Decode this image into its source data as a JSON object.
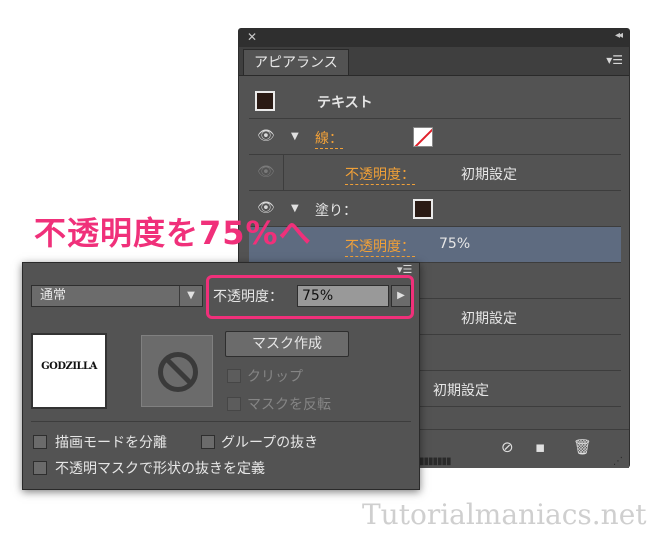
{
  "headline": "不透明度を75%へ",
  "appearance_panel": {
    "close_glyph": "✕",
    "collapse_glyph": "◂◂",
    "tab_label": "アピアランス",
    "menu_glyph": "▾☰",
    "object_label": "テキスト",
    "stroke_label": "線：",
    "stroke_opacity_label": "不透明度：",
    "stroke_opacity_value": "初期設定",
    "fill_label": "塗り：",
    "fill_opacity_label": "不透明度：",
    "fill_opacity_value": "75%",
    "row_value_4": "初期設定",
    "row_value_5": "初期設定",
    "icons": [
      "eye-icon",
      "no-symbol-icon",
      "new-item-icon",
      "trash-icon"
    ]
  },
  "transparency_popup": {
    "menu_glyph": "▾☰",
    "blend_mode": "通常",
    "opacity_label": "不透明度：",
    "opacity_value": "75%",
    "thumbnail_text": "GODZILLA",
    "make_mask_button": "マスク作成",
    "clip_label": "クリップ",
    "invert_mask_label": "マスクを反転",
    "isolate_blending_label": "描画モードを分離",
    "knockout_group_label": "グループの抜き",
    "opacity_mask_label": "不透明マスクで形状の抜きを定義"
  },
  "watermark": "Tutorialmaniacs.net",
  "colors": {
    "accent_pink": "#f0307a",
    "orange_label": "#f0a038",
    "panel_bg": "#535353",
    "selected_row": "#5e6b80"
  }
}
